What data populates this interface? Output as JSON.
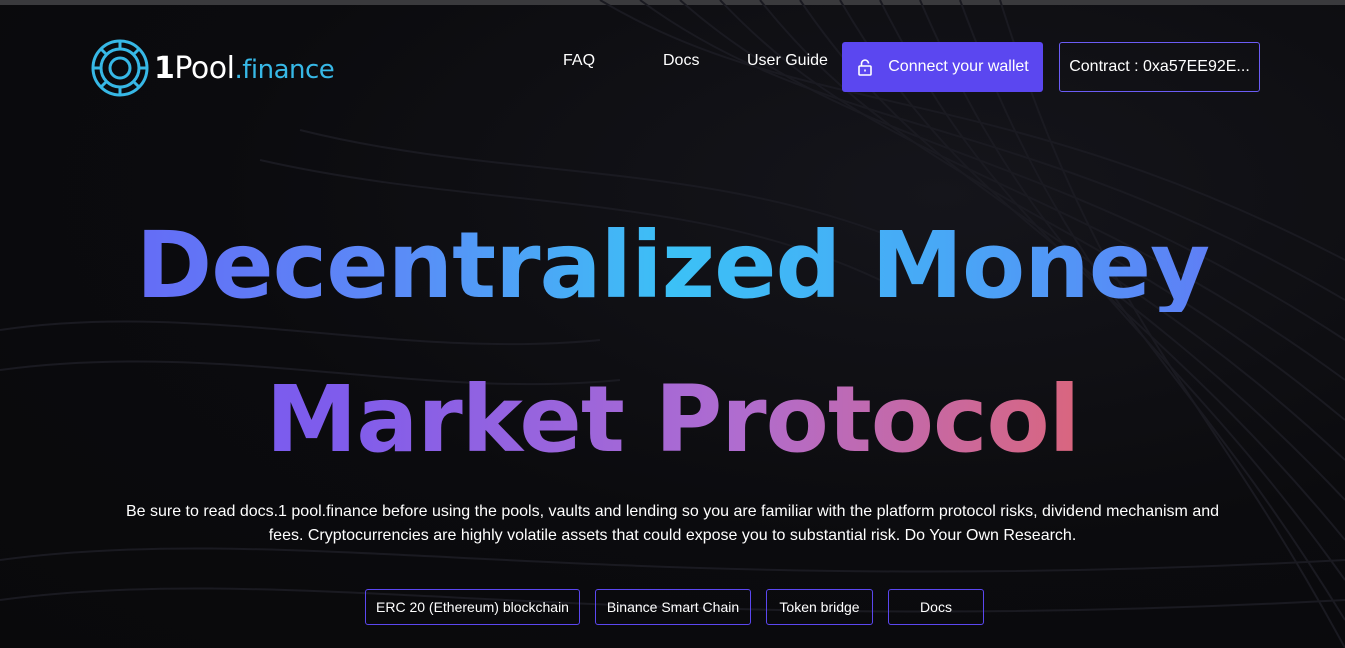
{
  "header": {
    "logo": {
      "brand_one": "1",
      "brand_pool": "Pool",
      "brand_finance": ".finance",
      "icon": "logo-ring-icon",
      "accent_color": "#37b8e6"
    },
    "nav": [
      {
        "label": "FAQ"
      },
      {
        "label": "Docs"
      },
      {
        "label": "User Guide"
      }
    ],
    "connect_button": {
      "label": "Connect your wallet",
      "icon": "lock-icon",
      "color": "#5b47f0"
    },
    "contract_button": {
      "label": "Contract : 0xa57EE92E..."
    }
  },
  "hero": {
    "line1": "Decentralized Money",
    "line2": "Market Protocol",
    "description": "Be sure to read docs.1 pool.finance before using the pools, vaults and lending so you are familiar with the platform protocol risks, dividend mechanism and fees. Cryptocurrencies are highly volatile assets that could expose you to substantial risk. Do Your Own Research."
  },
  "chips": [
    {
      "label": "ERC 20 (Ethereum) blockchain"
    },
    {
      "label": "Binance Smart Chain"
    },
    {
      "label": "Token bridge"
    },
    {
      "label": "Docs"
    }
  ],
  "colors": {
    "background": "#0b0b0e",
    "accent": "#5b47f0",
    "border": "#6b5cf5"
  }
}
